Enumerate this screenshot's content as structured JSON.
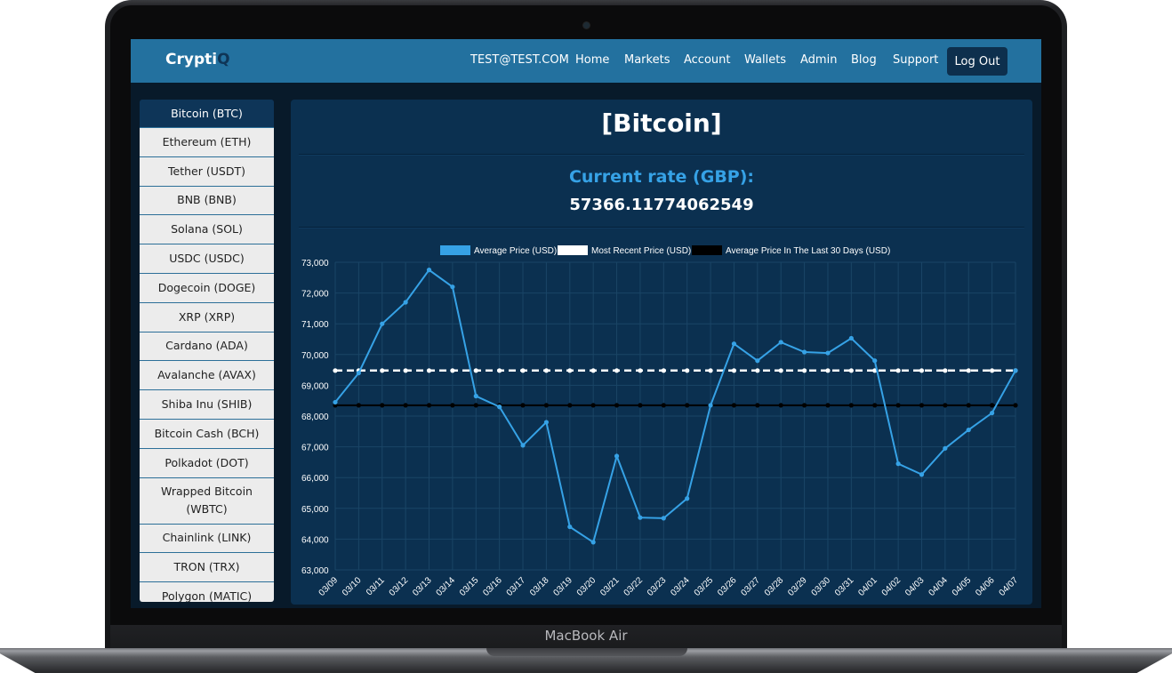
{
  "device": {
    "label": "MacBook Air"
  },
  "navbar": {
    "logo_part1": "Crypti",
    "logo_part2": "Q",
    "links": [
      "TEST@TEST.COM",
      "Home",
      "Markets",
      "Account",
      "Wallets",
      "Admin",
      "Blog",
      "Support"
    ],
    "logout_label": "Log Out"
  },
  "sidebar": {
    "items": [
      "Bitcoin (BTC)",
      "Ethereum (ETH)",
      "Tether (USDT)",
      "BNB (BNB)",
      "Solana (SOL)",
      "USDC (USDC)",
      "Dogecoin (DOGE)",
      "XRP (XRP)",
      "Cardano (ADA)",
      "Avalanche (AVAX)",
      "Shiba Inu (SHIB)",
      "Bitcoin Cash (BCH)",
      "Polkadot (DOT)",
      "Wrapped Bitcoin (WBTC)",
      "Chainlink (LINK)",
      "TRON (TRX)",
      "Polygon (MATIC)"
    ],
    "active_index": 0
  },
  "main": {
    "coin_title": "[Bitcoin]",
    "rate_label": "Current rate (GBP):",
    "rate_value": "57366.11774062549"
  },
  "colors": {
    "navbar": "#23719f",
    "accent_blue": "#36a2e6",
    "panel": "#0b3050",
    "active_sidebar": "#0e3558"
  },
  "chart_data": {
    "type": "line",
    "categories": [
      "03/09",
      "03/10",
      "03/11",
      "03/12",
      "03/13",
      "03/14",
      "03/15",
      "03/16",
      "03/17",
      "03/18",
      "03/19",
      "03/20",
      "03/21",
      "03/22",
      "03/23",
      "03/24",
      "03/25",
      "03/26",
      "03/27",
      "03/28",
      "03/29",
      "03/30",
      "03/31",
      "04/01",
      "04/02",
      "04/03",
      "04/04",
      "04/05",
      "04/06",
      "04/07"
    ],
    "series": [
      {
        "name": "Average Price (USD)",
        "color": "#36a2e6",
        "style": "solid",
        "values": [
          68450,
          69400,
          71000,
          71700,
          72750,
          72200,
          68650,
          68300,
          67050,
          67800,
          64400,
          63900,
          66700,
          64700,
          64680,
          65320,
          68350,
          70350,
          69800,
          70400,
          70080,
          70050,
          70530,
          69800,
          66450,
          66100,
          66950,
          67550,
          68100,
          69480
        ]
      },
      {
        "name": "Most Recent Price (USD)",
        "color": "#ffffff",
        "style": "dashed",
        "values": [
          69480,
          69480,
          69480,
          69480,
          69480,
          69480,
          69480,
          69480,
          69480,
          69480,
          69480,
          69480,
          69480,
          69480,
          69480,
          69480,
          69480,
          69480,
          69480,
          69480,
          69480,
          69480,
          69480,
          69480,
          69480,
          69480,
          69480,
          69480,
          69480,
          69480
        ]
      },
      {
        "name": "Average Price In The Last 30 Days (USD)",
        "color": "#000000",
        "style": "solid",
        "values": [
          68350,
          68350,
          68350,
          68350,
          68350,
          68350,
          68350,
          68350,
          68350,
          68350,
          68350,
          68350,
          68350,
          68350,
          68350,
          68350,
          68350,
          68350,
          68350,
          68350,
          68350,
          68350,
          68350,
          68350,
          68350,
          68350,
          68350,
          68350,
          68350,
          68350
        ]
      }
    ],
    "yticks": [
      "73,000",
      "72,000",
      "71,000",
      "70,000",
      "69,000",
      "68,000",
      "67,000",
      "66,000",
      "65,000",
      "64,000",
      "63,000"
    ],
    "ylim": [
      63000,
      73000
    ],
    "grid": true,
    "legend": "top"
  }
}
